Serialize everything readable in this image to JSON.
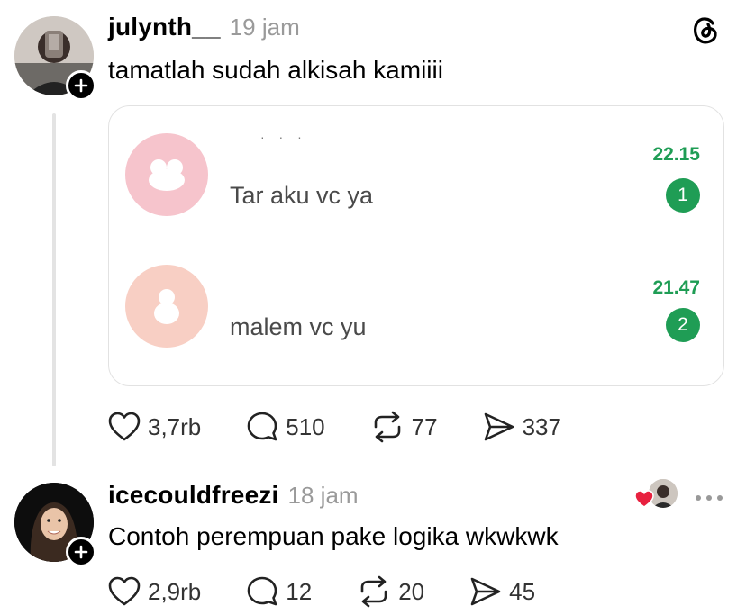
{
  "post": {
    "username": "julynth__",
    "time": "19 jam",
    "text": "tamatlah sudah alkisah kamiiii",
    "chat_preview": {
      "header_fragment": "· · ·",
      "messages": [
        {
          "text": "Tar aku vc ya",
          "time": "22.15",
          "unread": "1",
          "avatar_color": "#f6c4cc"
        },
        {
          "text": "malem vc yu",
          "time": "21.47",
          "unread": "2",
          "avatar_color": "#f8cfc4"
        }
      ]
    },
    "stats": {
      "likes": "3,7rb",
      "replies": "510",
      "reposts": "77",
      "shares": "337"
    }
  },
  "reply": {
    "username": "icecouldfreezi",
    "time": "18 jam",
    "text": "Contoh perempuan pake logika wkwkwk",
    "stats": {
      "likes": "2,9rb",
      "replies": "12",
      "reposts": "20",
      "shares": "45"
    }
  },
  "icons": {
    "app_logo": "threads-logo-icon",
    "like": "heart-icon",
    "reply": "comment-icon",
    "repost": "repost-icon",
    "share": "send-icon",
    "more": "more-icon",
    "follow": "plus-icon"
  },
  "colors": {
    "accent_green": "#1f9d55",
    "heart_red": "#e8213f"
  }
}
